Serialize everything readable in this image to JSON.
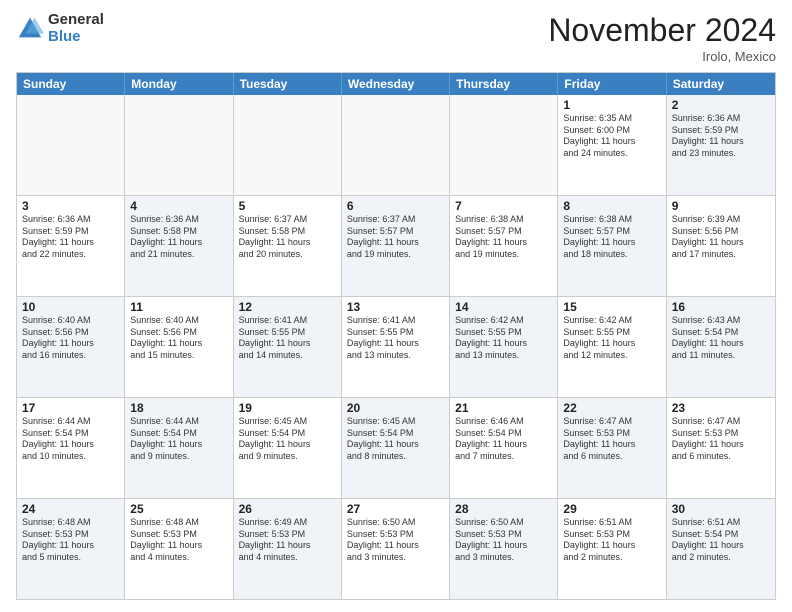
{
  "logo": {
    "general": "General",
    "blue": "Blue"
  },
  "header": {
    "month": "November 2024",
    "location": "Irolo, Mexico"
  },
  "weekdays": [
    "Sunday",
    "Monday",
    "Tuesday",
    "Wednesday",
    "Thursday",
    "Friday",
    "Saturday"
  ],
  "rows": [
    [
      {
        "day": "",
        "empty": true
      },
      {
        "day": "",
        "empty": true
      },
      {
        "day": "",
        "empty": true
      },
      {
        "day": "",
        "empty": true
      },
      {
        "day": "",
        "empty": true
      },
      {
        "day": "1",
        "lines": [
          "Sunrise: 6:35 AM",
          "Sunset: 6:00 PM",
          "Daylight: 11 hours",
          "and 24 minutes."
        ]
      },
      {
        "day": "2",
        "lines": [
          "Sunrise: 6:36 AM",
          "Sunset: 5:59 PM",
          "Daylight: 11 hours",
          "and 23 minutes."
        ],
        "shaded": true
      }
    ],
    [
      {
        "day": "3",
        "lines": [
          "Sunrise: 6:36 AM",
          "Sunset: 5:59 PM",
          "Daylight: 11 hours",
          "and 22 minutes."
        ]
      },
      {
        "day": "4",
        "lines": [
          "Sunrise: 6:36 AM",
          "Sunset: 5:58 PM",
          "Daylight: 11 hours",
          "and 21 minutes."
        ],
        "shaded": true
      },
      {
        "day": "5",
        "lines": [
          "Sunrise: 6:37 AM",
          "Sunset: 5:58 PM",
          "Daylight: 11 hours",
          "and 20 minutes."
        ]
      },
      {
        "day": "6",
        "lines": [
          "Sunrise: 6:37 AM",
          "Sunset: 5:57 PM",
          "Daylight: 11 hours",
          "and 19 minutes."
        ],
        "shaded": true
      },
      {
        "day": "7",
        "lines": [
          "Sunrise: 6:38 AM",
          "Sunset: 5:57 PM",
          "Daylight: 11 hours",
          "and 19 minutes."
        ]
      },
      {
        "day": "8",
        "lines": [
          "Sunrise: 6:38 AM",
          "Sunset: 5:57 PM",
          "Daylight: 11 hours",
          "and 18 minutes."
        ],
        "shaded": true
      },
      {
        "day": "9",
        "lines": [
          "Sunrise: 6:39 AM",
          "Sunset: 5:56 PM",
          "Daylight: 11 hours",
          "and 17 minutes."
        ]
      }
    ],
    [
      {
        "day": "10",
        "lines": [
          "Sunrise: 6:40 AM",
          "Sunset: 5:56 PM",
          "Daylight: 11 hours",
          "and 16 minutes."
        ],
        "shaded": true
      },
      {
        "day": "11",
        "lines": [
          "Sunrise: 6:40 AM",
          "Sunset: 5:56 PM",
          "Daylight: 11 hours",
          "and 15 minutes."
        ]
      },
      {
        "day": "12",
        "lines": [
          "Sunrise: 6:41 AM",
          "Sunset: 5:55 PM",
          "Daylight: 11 hours",
          "and 14 minutes."
        ],
        "shaded": true
      },
      {
        "day": "13",
        "lines": [
          "Sunrise: 6:41 AM",
          "Sunset: 5:55 PM",
          "Daylight: 11 hours",
          "and 13 minutes."
        ]
      },
      {
        "day": "14",
        "lines": [
          "Sunrise: 6:42 AM",
          "Sunset: 5:55 PM",
          "Daylight: 11 hours",
          "and 13 minutes."
        ],
        "shaded": true
      },
      {
        "day": "15",
        "lines": [
          "Sunrise: 6:42 AM",
          "Sunset: 5:55 PM",
          "Daylight: 11 hours",
          "and 12 minutes."
        ]
      },
      {
        "day": "16",
        "lines": [
          "Sunrise: 6:43 AM",
          "Sunset: 5:54 PM",
          "Daylight: 11 hours",
          "and 11 minutes."
        ],
        "shaded": true
      }
    ],
    [
      {
        "day": "17",
        "lines": [
          "Sunrise: 6:44 AM",
          "Sunset: 5:54 PM",
          "Daylight: 11 hours",
          "and 10 minutes."
        ]
      },
      {
        "day": "18",
        "lines": [
          "Sunrise: 6:44 AM",
          "Sunset: 5:54 PM",
          "Daylight: 11 hours",
          "and 9 minutes."
        ],
        "shaded": true
      },
      {
        "day": "19",
        "lines": [
          "Sunrise: 6:45 AM",
          "Sunset: 5:54 PM",
          "Daylight: 11 hours",
          "and 9 minutes."
        ]
      },
      {
        "day": "20",
        "lines": [
          "Sunrise: 6:45 AM",
          "Sunset: 5:54 PM",
          "Daylight: 11 hours",
          "and 8 minutes."
        ],
        "shaded": true
      },
      {
        "day": "21",
        "lines": [
          "Sunrise: 6:46 AM",
          "Sunset: 5:54 PM",
          "Daylight: 11 hours",
          "and 7 minutes."
        ]
      },
      {
        "day": "22",
        "lines": [
          "Sunrise: 6:47 AM",
          "Sunset: 5:53 PM",
          "Daylight: 11 hours",
          "and 6 minutes."
        ],
        "shaded": true
      },
      {
        "day": "23",
        "lines": [
          "Sunrise: 6:47 AM",
          "Sunset: 5:53 PM",
          "Daylight: 11 hours",
          "and 6 minutes."
        ]
      }
    ],
    [
      {
        "day": "24",
        "lines": [
          "Sunrise: 6:48 AM",
          "Sunset: 5:53 PM",
          "Daylight: 11 hours",
          "and 5 minutes."
        ],
        "shaded": true
      },
      {
        "day": "25",
        "lines": [
          "Sunrise: 6:48 AM",
          "Sunset: 5:53 PM",
          "Daylight: 11 hours",
          "and 4 minutes."
        ]
      },
      {
        "day": "26",
        "lines": [
          "Sunrise: 6:49 AM",
          "Sunset: 5:53 PM",
          "Daylight: 11 hours",
          "and 4 minutes."
        ],
        "shaded": true
      },
      {
        "day": "27",
        "lines": [
          "Sunrise: 6:50 AM",
          "Sunset: 5:53 PM",
          "Daylight: 11 hours",
          "and 3 minutes."
        ]
      },
      {
        "day": "28",
        "lines": [
          "Sunrise: 6:50 AM",
          "Sunset: 5:53 PM",
          "Daylight: 11 hours",
          "and 3 minutes."
        ],
        "shaded": true
      },
      {
        "day": "29",
        "lines": [
          "Sunrise: 6:51 AM",
          "Sunset: 5:53 PM",
          "Daylight: 11 hours",
          "and 2 minutes."
        ]
      },
      {
        "day": "30",
        "lines": [
          "Sunrise: 6:51 AM",
          "Sunset: 5:54 PM",
          "Daylight: 11 hours",
          "and 2 minutes."
        ],
        "shaded": true
      }
    ]
  ]
}
